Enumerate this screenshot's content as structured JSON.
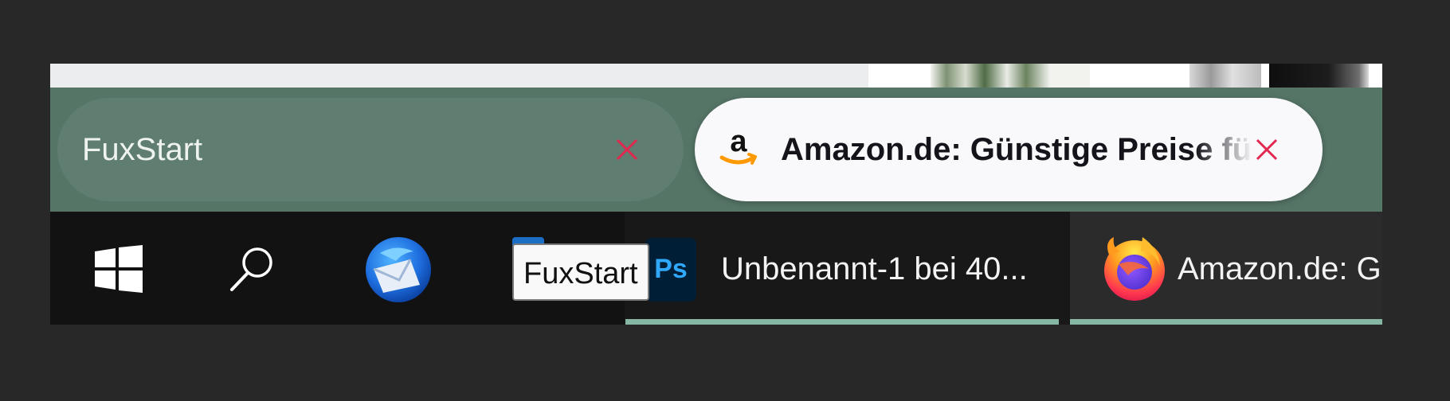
{
  "tabs": [
    {
      "title": "FuxStart",
      "favicon": "none",
      "active": false,
      "close_icon": "close-icon"
    },
    {
      "title": "Amazon.de: Günstige Preise für Elektronik & Foto, Filme, Musik, Bücher, Games, Spielzeug & mehr",
      "favicon": "amazon-logo-icon",
      "active": true,
      "close_icon": "close-icon"
    }
  ],
  "taskbar": {
    "start_icon": "windows-logo-icon",
    "search_icon": "search-icon",
    "pinned": [
      {
        "app": "Thunderbird",
        "icon": "thunderbird-icon"
      },
      {
        "app": "Outlook",
        "icon": "outlook-icon"
      }
    ],
    "windows": [
      {
        "app": "Photoshop",
        "icon": "photoshop-icon",
        "icon_text": "Ps",
        "label": "Unbenannt-1 bei 40..."
      },
      {
        "app": "Firefox",
        "icon": "firefox-icon",
        "label": "Amazon.de: Günstige Preise"
      }
    ]
  },
  "tooltip": {
    "text": "FuxStart"
  },
  "colors": {
    "tabbar_bg": "#557567",
    "inactive_tab": "#5f7d71",
    "active_tab": "#f9f9fb",
    "close_x": "#e22850",
    "taskbar_bg": "#121212",
    "running_indicator": "#85b7a4",
    "amazon_orange": "#ff9900"
  }
}
